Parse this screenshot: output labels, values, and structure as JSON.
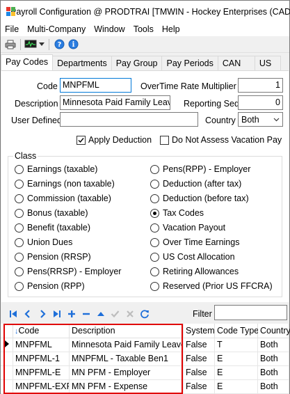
{
  "window": {
    "title": "Payroll Configuration @ PRODTRAI [TMWIN - Hockey Enterprises (CAD)]"
  },
  "menu": {
    "items": [
      "File",
      "Multi-Company",
      "Window",
      "Tools",
      "Help"
    ]
  },
  "toolbar": {
    "icons": [
      "printer-icon",
      "monitor-icon",
      "dropdown-arrow-icon",
      "help-icon",
      "info-icon"
    ]
  },
  "tabs": [
    "Pay Codes",
    "Departments",
    "Pay Group",
    "Pay Periods",
    "CAN",
    "US"
  ],
  "form": {
    "code_label": "Code",
    "code_value": "MNPFML",
    "description_label": "Description",
    "description_value": "Minnesota Paid Family Leave",
    "user_defined_label": "User Defined",
    "user_defined_value": "",
    "overtime_label": "OverTime Rate Multiplier",
    "overtime_value": "1",
    "reporting_label": "Reporting Seq",
    "reporting_value": "0",
    "country_label": "Country",
    "country_value": "Both",
    "apply_deduction_label": "Apply Deduction",
    "apply_deduction_checked": true,
    "not_assess_label": "Do Not Assess Vacation Pay",
    "not_assess_checked": false
  },
  "class_group": {
    "title": "Class",
    "left": [
      "Earnings (taxable)",
      "Earnings (non taxable)",
      "Commission (taxable)",
      "Bonus (taxable)",
      "Benefit (taxable)",
      "Union Dues",
      "Pension (RRSP)",
      "Pens(RRSP) - Employer",
      "Pension (RPP)"
    ],
    "right": [
      "Pens(RPP) - Employer",
      "Deduction (after tax)",
      "Deduction (before tax)",
      "Tax Codes",
      "Vacation Payout",
      "Over Time Earnings",
      "US Cost Allocation",
      "Retiring Allowances",
      "Reserved (Prior US FFCRA)"
    ],
    "selected": "Tax Codes"
  },
  "nav": {
    "filter_label": "Filter",
    "filter_value": ""
  },
  "grid": {
    "columns": [
      "Code",
      "Description",
      "System",
      "Code Type",
      "Country"
    ],
    "rows": [
      [
        "MNPFML",
        "Minnesota Paid Family Leave",
        "False",
        "T",
        "Both"
      ],
      [
        "MNPFML-1",
        "MNPFML - Taxable Ben1",
        "False",
        "E",
        "Both"
      ],
      [
        "MNPFML-E",
        "MN PFM - Employer",
        "False",
        "E",
        "Both"
      ],
      [
        "MNPFML-EXP",
        "MN PFM - Expense",
        "False",
        "E",
        "Both"
      ]
    ],
    "current_row": 0
  },
  "colors": {
    "accent_blue": "#1e6fd9",
    "highlight_red": "#e00000",
    "focus_border": "#0078d7"
  }
}
